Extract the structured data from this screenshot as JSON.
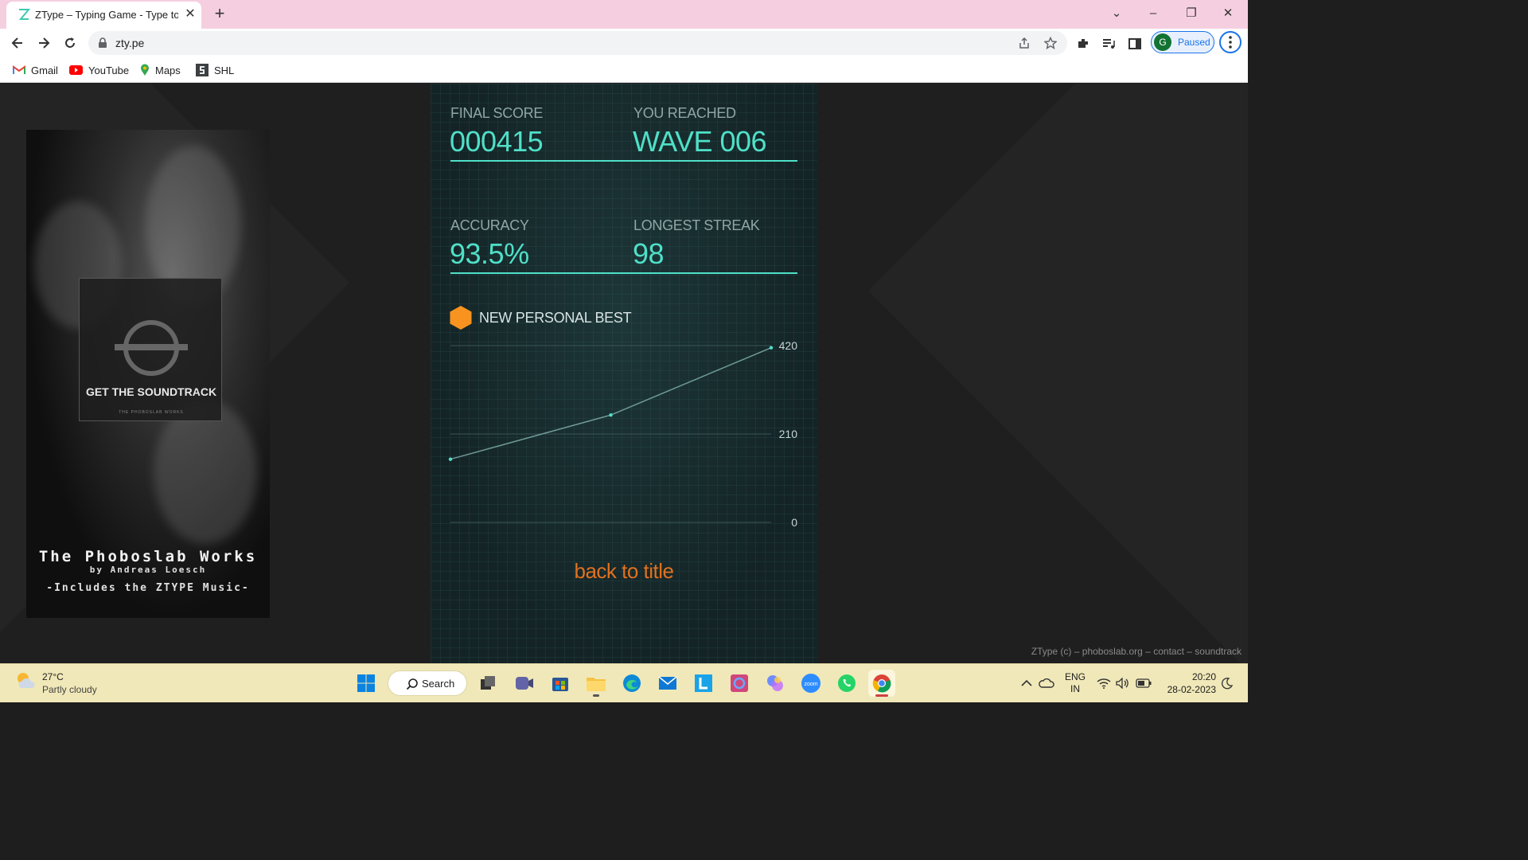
{
  "browser": {
    "tab_title": "ZType – Typing Game - Type to S",
    "tab_favicon": "ztype-z-icon",
    "url": "zty.pe",
    "profile_initial": "G",
    "profile_status": "Paused"
  },
  "bookmarks": [
    {
      "label": "Gmail",
      "icon": "gmail-icon"
    },
    {
      "label": "YouTube",
      "icon": "youtube-icon"
    },
    {
      "label": "Maps",
      "icon": "maps-icon"
    },
    {
      "label": "SHL",
      "icon": "shl-icon"
    }
  ],
  "ad": {
    "cta": "GET THE SOUNDTRACK",
    "small_text": "THE PHOBOSLAB WORKS",
    "title": "The Phoboslab Works",
    "author": "by Andreas Loesch",
    "subtitle": "-Includes the ZTYPE Music-"
  },
  "game": {
    "final_score_label": "FINAL SCORE",
    "final_score": "000415",
    "wave_label": "YOU REACHED",
    "wave": "WAVE 006",
    "accuracy_label": "ACCURACY",
    "accuracy": "93.5%",
    "streak_label": "LONGEST STREAK",
    "streak": "98",
    "personal_best": "NEW PERSONAL BEST",
    "back_to_title": "back to title",
    "accent_color": "#4fe0c8",
    "link_color": "#e0711f",
    "badge_color": "#f7931e"
  },
  "chart_data": {
    "type": "line",
    "x": [
      1,
      2,
      3
    ],
    "series": [
      {
        "values": [
          150,
          255,
          415
        ]
      }
    ],
    "ylim": [
      0,
      420
    ],
    "yticks": [
      "420",
      "210",
      "0"
    ],
    "grid": true
  },
  "footer": {
    "prefix": "ZType (c) –",
    "phoboslab": "phoboslab.org",
    "sep1": "–",
    "contact": "contact",
    "sep2": "–",
    "soundtrack": "soundtrack"
  },
  "taskbar": {
    "weather_temp": "27°C",
    "weather_desc": "Partly cloudy",
    "search_label": "Search",
    "lang_line1": "ENG",
    "lang_line2": "IN",
    "time": "20:20",
    "date": "28-02-2023"
  }
}
